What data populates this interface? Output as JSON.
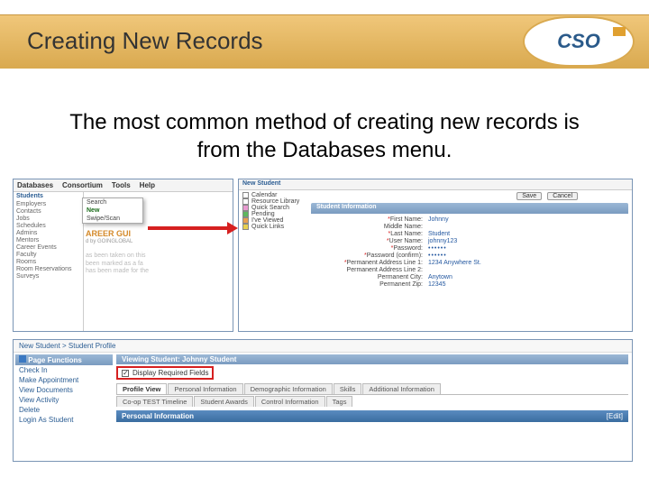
{
  "slide": {
    "title": "Creating New Records",
    "body": "The most common method of creating new records is from the Databases menu.",
    "logo_text": "CSO"
  },
  "s1": {
    "menubar": [
      "Databases",
      "Consortium",
      "Tools",
      "Help"
    ],
    "side_header": "Students",
    "side_items": [
      "Employers",
      "Contacts",
      "Jobs",
      "Schedules",
      "Admins",
      "Mentors",
      "Career Events",
      "Faculty",
      "Rooms",
      "Room Reservations",
      "Surveys"
    ],
    "flyout": [
      "Search",
      "New",
      "Swipe/Scan"
    ],
    "bg_title": "AREER GUI",
    "bg_sub": "d by GOINGLOBAL",
    "bg_text1": "as been taken on this",
    "bg_text2": "been marked as a fa",
    "bg_text3": "has been made for the"
  },
  "s2": {
    "crumb": "New Student",
    "buttons": {
      "save": "Save",
      "cancel": "Cancel"
    },
    "side": [
      "Calendar",
      "Resource Library",
      "Quick Search",
      "Pending",
      "I've Viewed",
      "Quick Links"
    ],
    "section": "Student Information",
    "fields": {
      "first_lab": "First Name:",
      "first": "Johnny",
      "middle_lab": "Middle Name:",
      "middle": "",
      "last_lab": "Last Name:",
      "last": "Student",
      "user_lab": "User Name:",
      "user": "johnny123",
      "pw_lab": "Password:",
      "pw": "••••••",
      "pwc_lab": "Password (confirm):",
      "pwc": "••••••",
      "addr1_lab": "Permanent Address Line 1:",
      "addr1": "1234 Anywhere St.",
      "addr2_lab": "Permanent Address Line 2:",
      "addr2": "",
      "city_lab": "Permanent City:",
      "city": "Anytown",
      "zip_lab": "Permanent Zip:",
      "zip": "12345"
    }
  },
  "s3": {
    "crumb": "New Student > Student Profile",
    "left_header": "Page Functions",
    "left_links": [
      "Check In",
      "Make Appointment",
      "View Documents",
      "View Activity",
      "Delete",
      "Login As Student"
    ],
    "viewing_label": "Viewing Student:",
    "viewing_name": "Johnny Student",
    "checkbox_label": "Display Required Fields",
    "tabs": [
      "Profile View",
      "Personal Information",
      "Demographic Information",
      "Skills",
      "Additional Information"
    ],
    "subtabs": [
      "Co-op TEST Timeline",
      "Student Awards",
      "Control Information",
      "Tags"
    ],
    "section": "Personal Information",
    "edit": "[Edit]"
  }
}
